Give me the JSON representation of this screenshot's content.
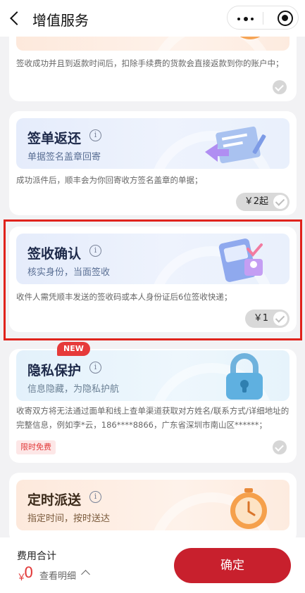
{
  "header": {
    "title": "增值服务",
    "more_icon": "more-dots-icon",
    "target_icon": "target-icon"
  },
  "cards": [
    {
      "title": "",
      "description": "签收成功并且到返款时间后，扣除手续费的货款会直接返款到你的账户中；"
    },
    {
      "title": "签单返还",
      "subtitle": "单据签名盖章回寄",
      "description": "成功派件后，顺丰会为你回寄收方签名盖章的单据；",
      "price": "￥2起"
    },
    {
      "title": "签收确认",
      "subtitle": "核实身份，当面签收",
      "description": "收件人需凭顺丰发送的签收码或本人身份证后6位签收快递；",
      "price": "￥1"
    },
    {
      "badge": "NEW",
      "title": "隐私保护",
      "subtitle": "信息隐藏，为隐私护航",
      "description_line1": "收寄双方将无法通过面单和线上查单渠道获取对方姓名/联系方式/详细地址的",
      "description_line2": "完整信息，例如李*云，186****8866，广东省深圳市南山区******；",
      "tag": "限时免费"
    },
    {
      "title": "定时派送",
      "subtitle": "指定时间，按时送达"
    }
  ],
  "footer": {
    "total_label": "费用合计",
    "currency": "￥",
    "amount": "0",
    "detail_label": "查看明细",
    "confirm_label": "确定"
  },
  "colors": {
    "accent": "#c8202d",
    "highlight_border": "#e0231c"
  }
}
